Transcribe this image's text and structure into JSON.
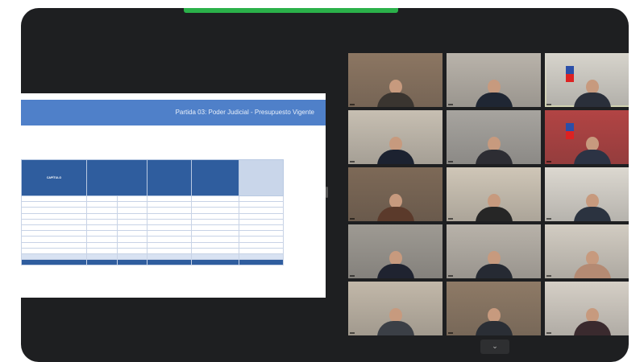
{
  "top_bar": {
    "center_text": "",
    "right_text": ""
  },
  "slide": {
    "title": "Partida 03: Poder Judicial - Presupuesto Vigente",
    "subtitle": "",
    "columns": [
      "CAPÍTULO",
      "",
      "",
      "",
      ""
    ],
    "page_number": ""
  },
  "participants": [
    {
      "name": ""
    },
    {
      "name": ""
    },
    {
      "name": ""
    },
    {
      "name": ""
    },
    {
      "name": ""
    },
    {
      "name": ""
    },
    {
      "name": ""
    },
    {
      "name": ""
    },
    {
      "name": ""
    },
    {
      "name": ""
    },
    {
      "name": ""
    },
    {
      "name": ""
    },
    {
      "name": ""
    },
    {
      "name": ""
    },
    {
      "name": ""
    }
  ],
  "colors": {
    "share_indicator": "#2bb14a",
    "active_speaker": "#b7c940",
    "slide_header": "#4f80c9",
    "table_header": "#2f5d9e"
  },
  "icons": {
    "gallery_toggle": "chevron-down-icon"
  }
}
